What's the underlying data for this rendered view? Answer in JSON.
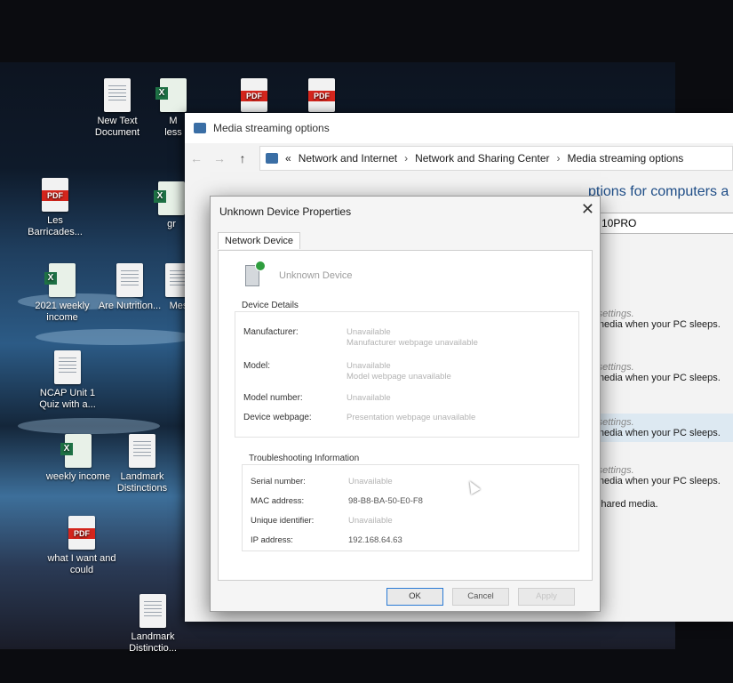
{
  "desktop": {
    "icons": [
      {
        "label": "New Text Document",
        "type": "doc"
      },
      {
        "label": "M\nless",
        "type": "xls"
      },
      {
        "label": "",
        "type": "pdf"
      },
      {
        "label": "",
        "type": "pdf"
      },
      {
        "label": "Les Barricades...",
        "type": "pdf"
      },
      {
        "label": "gr",
        "type": "xls"
      },
      {
        "label": "2021 weekly income",
        "type": "xls"
      },
      {
        "label": "Are Nutrition...",
        "type": "doc"
      },
      {
        "label": "Mes",
        "type": "doc"
      },
      {
        "label": "NCAP Unit 1 Quiz with a...",
        "type": "doc"
      },
      {
        "label": "weekly income",
        "type": "xls"
      },
      {
        "label": "Landmark Distinctions",
        "type": "doc"
      },
      {
        "label": "what I want and could",
        "type": "pdf"
      },
      {
        "label": "Landmark Distinctio...",
        "type": "doc"
      }
    ]
  },
  "media_window": {
    "title": "Media streaming options",
    "breadcrumb": {
      "prefix": "«",
      "items": [
        "Network and Internet",
        "Network and Sharing Center",
        "Media streaming options"
      ]
    },
    "heading": "ptions for computers a",
    "pc_name": "10PRO",
    "rows": [
      {
        "hint": "ult settings.",
        "text": "ur media when your PC sleeps."
      },
      {
        "hint": "ult settings.",
        "text": "ur media when your PC sleeps."
      },
      {
        "hint": "ult settings.",
        "text": "ur media when your PC sleeps."
      },
      {
        "hint": "ult settings.",
        "text": "ur media when your PC sleeps."
      },
      {
        "hint": "",
        "text": "ur shared media."
      }
    ]
  },
  "dialog": {
    "title": "Unknown Device Properties",
    "close_symbol": "✕",
    "tab_label": "Network Device",
    "device_name": "Unknown Device",
    "device_details_label": "Device Details",
    "device_details": [
      {
        "label": "Manufacturer:",
        "value": "Unavailable",
        "sub": "Manufacturer webpage unavailable"
      },
      {
        "label": "Model:",
        "value": "Unavailable",
        "sub": "Model webpage unavailable"
      },
      {
        "label": "Model number:",
        "value": "Unavailable",
        "sub": ""
      },
      {
        "label": "Device webpage:",
        "value": "Presentation webpage unavailable",
        "sub": ""
      }
    ],
    "troubleshooting_label": "Troubleshooting Information",
    "troubleshooting": [
      {
        "label": "Serial number:",
        "value": "Unavailable"
      },
      {
        "label": "MAC address:",
        "value": "98-B8-BA-50-E0-F8"
      },
      {
        "label": "Unique identifier:",
        "value": "Unavailable"
      },
      {
        "label": "IP address:",
        "value": "192.168.64.63"
      }
    ],
    "buttons": {
      "ok": "OK",
      "cancel": "Cancel",
      "apply": "Apply"
    }
  },
  "colors": {
    "accent": "#2a7ad5",
    "heading": "#1d4c86",
    "pdf": "#d4251c",
    "excel": "#1e7145"
  }
}
